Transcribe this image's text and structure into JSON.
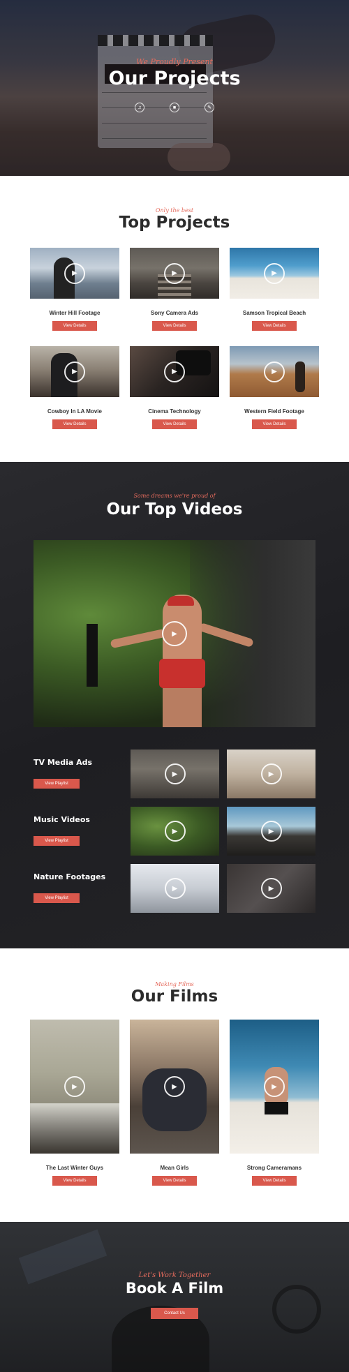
{
  "hero": {
    "subtitle": "We Proudly Present",
    "title": "Our Projects",
    "icons": [
      "volume-icon",
      "camera-icon",
      "edit-icon"
    ]
  },
  "projects": {
    "subtitle": "Only the best",
    "title": "Top Projects",
    "button_label": "View Details",
    "items": [
      {
        "title": "Winter Hill Footage"
      },
      {
        "title": "Sony Camera Ads"
      },
      {
        "title": "Samson Tropical Beach"
      },
      {
        "title": "Cowboy In LA Movie"
      },
      {
        "title": "Cinema Technology"
      },
      {
        "title": "Western Field Footage"
      }
    ]
  },
  "videos": {
    "subtitle": "Some dreams we're proud of",
    "title": "Our Top Videos",
    "button_label": "View Playlist",
    "rows": [
      {
        "label": "TV Media Ads"
      },
      {
        "label": "Music Videos"
      },
      {
        "label": "Nature Footages"
      }
    ]
  },
  "films": {
    "subtitle": "Making Films",
    "title": "Our Films",
    "button_label": "View Details",
    "items": [
      {
        "title": "The Last Winter Guys"
      },
      {
        "title": "Mean Girls"
      },
      {
        "title": "Strong Cameramans"
      }
    ]
  },
  "book": {
    "subtitle": "Let's Work Together",
    "title": "Book A Film",
    "button_label": "Contact Us"
  },
  "colors": {
    "accent": "#d9584c",
    "dark": "#1f1f22",
    "heading": "#2b2b2b"
  }
}
